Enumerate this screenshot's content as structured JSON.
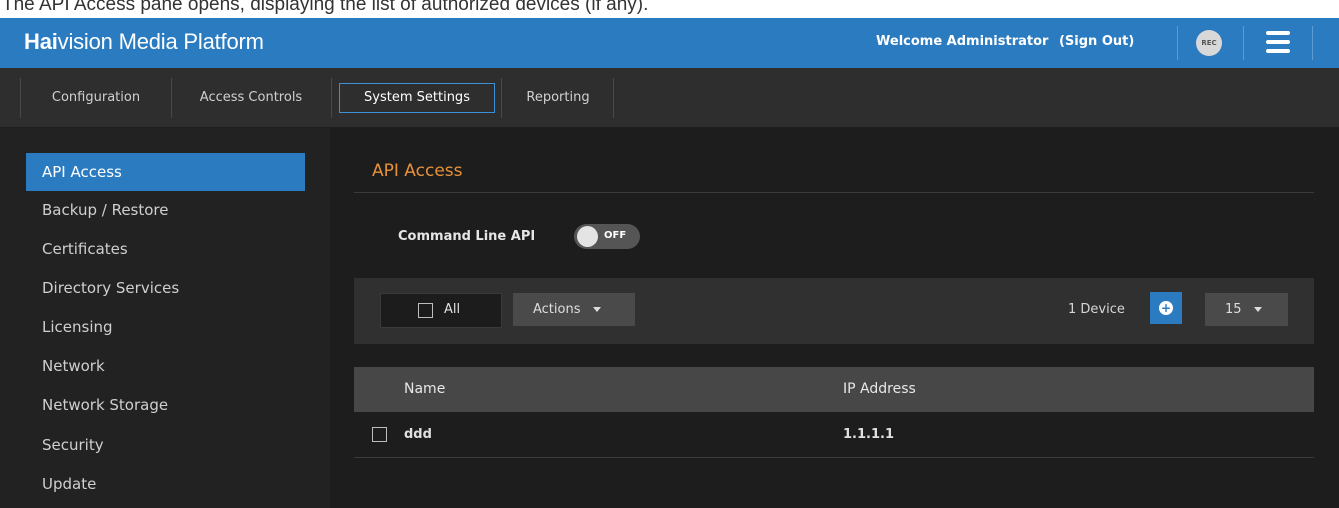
{
  "caption": "The API Access pane opens, displaying the list of authorized devices (if any).",
  "header": {
    "brand_bold": "Hai",
    "brand_rest": "vision Media Platform",
    "welcome": "Welcome Administrator",
    "sign_out": "(Sign Out)",
    "rec_label": "REC",
    "accent_color": "#2b7bc1"
  },
  "nav": {
    "tabs": [
      "Configuration",
      "Access Controls",
      "System Settings",
      "Reporting"
    ],
    "active": "System Settings"
  },
  "sidebar": {
    "items": [
      {
        "label": "API Access"
      },
      {
        "label": "Backup / Restore"
      },
      {
        "label": "Certificates"
      },
      {
        "label": "Directory Services"
      },
      {
        "label": "Licensing"
      },
      {
        "label": "Network"
      },
      {
        "label": "Network Storage"
      },
      {
        "label": "Security"
      },
      {
        "label": "Update"
      }
    ],
    "active": "API Access"
  },
  "main": {
    "title": "API Access",
    "title_color": "#e8913a",
    "command_line_api": {
      "label": "Command Line API",
      "state": "OFF"
    },
    "toolbar": {
      "select_all_label": "All",
      "actions_label": "Actions",
      "device_count": "1 Device",
      "page_size": "15"
    },
    "table": {
      "columns": [
        "Name",
        "IP Address"
      ],
      "rows": [
        {
          "name": "ddd",
          "ip": "1.1.1.1"
        }
      ]
    }
  }
}
